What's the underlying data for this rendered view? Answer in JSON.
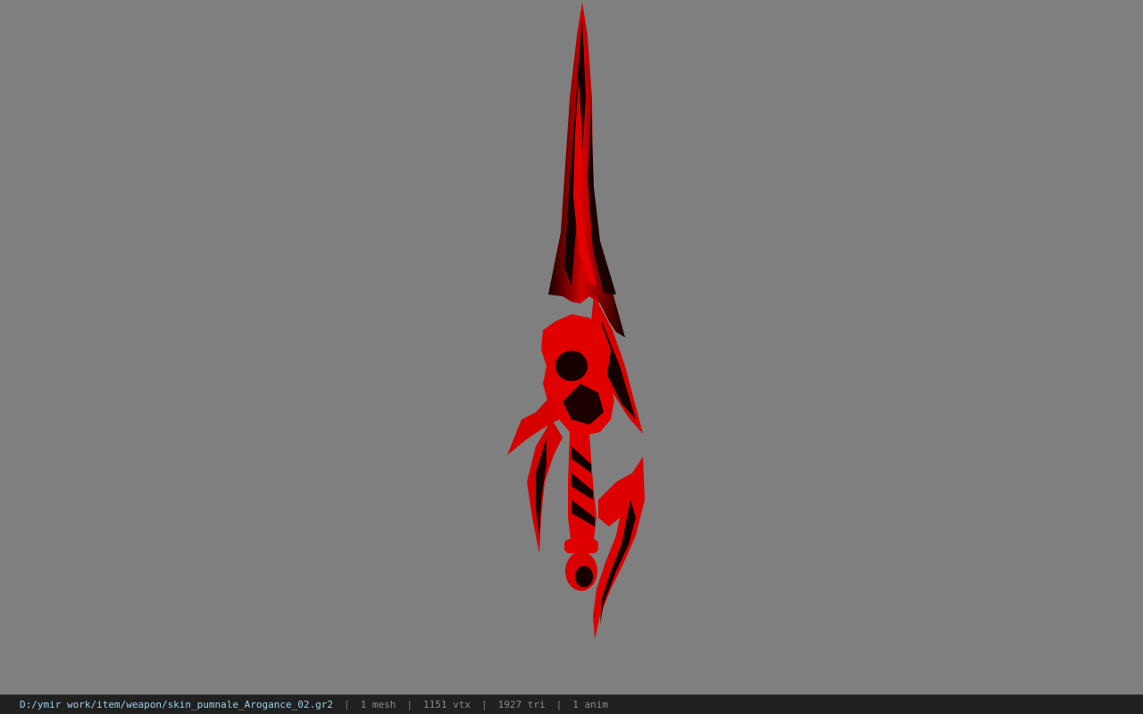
{
  "viewport": {
    "background_color": "#7f7f7f",
    "model": {
      "name": "red-dagger-model",
      "primary_color": "#e00000",
      "shadow_color": "#140000"
    }
  },
  "statusbar": {
    "file_path": "D:/ymir work/item/weapon/skin_pumnale_Arogance_02.gr2",
    "separator": "|",
    "mesh_count": "1 mesh",
    "vertex_count": "1151 vtx",
    "triangle_count": "1927 tri",
    "anim_count": "1 anim",
    "path_color": "#9ecfe6",
    "text_color": "#8a8a8a"
  }
}
